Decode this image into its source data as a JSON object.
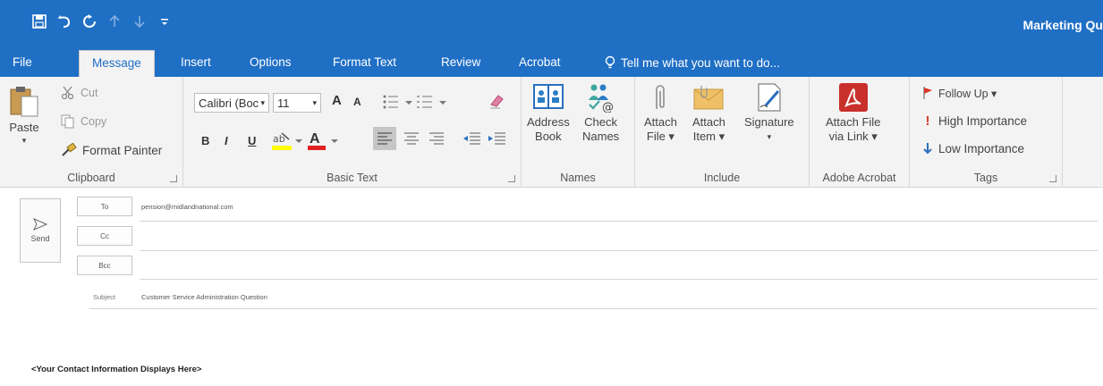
{
  "window": {
    "title": "Marketing Qu"
  },
  "qat": {
    "items": [
      {
        "name": "save-icon",
        "glyph": "🖫"
      },
      {
        "name": "undo-icon",
        "glyph": "↶"
      },
      {
        "name": "redo-icon",
        "glyph": "↻"
      },
      {
        "name": "up-icon",
        "glyph": "↑"
      },
      {
        "name": "down-icon",
        "glyph": "↓"
      },
      {
        "name": "customize-icon",
        "glyph": "="
      }
    ]
  },
  "tabs": [
    {
      "label": "File"
    },
    {
      "label": "Message"
    },
    {
      "label": "Insert"
    },
    {
      "label": "Options"
    },
    {
      "label": "Format Text"
    },
    {
      "label": "Review"
    },
    {
      "label": "Acrobat"
    }
  ],
  "tellme": {
    "label": "Tell me what you want to do..."
  },
  "clipboard": {
    "paste": "Paste",
    "cut": "Cut",
    "copy": "Copy",
    "format_painter": "Format Painter",
    "label": "Clipboard"
  },
  "basic_text": {
    "font": "Calibri (Boc",
    "size": "11",
    "bold": "B",
    "italic": "I",
    "underline": "U",
    "grow": "A",
    "shrink": "A",
    "font_color": "A",
    "label": "Basic Text"
  },
  "names": {
    "address_book_1": "Address",
    "address_book_2": "Book",
    "check_names_1": "Check",
    "check_names_2": "Names",
    "label": "Names"
  },
  "include": {
    "attach_file_1": "Attach",
    "attach_file_2": "File ▾",
    "attach_item_1": "Attach",
    "attach_item_2": "Item ▾",
    "signature_1": "Signature",
    "signature_2": "▾",
    "label": "Include"
  },
  "adobe": {
    "attach_link_1": "Attach File",
    "attach_link_2": "via Link ▾",
    "label": "Adobe Acrobat"
  },
  "tags": {
    "follow_up": "Follow Up ▾",
    "high": "High Importance",
    "low": "Low Importance",
    "label": "Tags"
  },
  "compose": {
    "send": "Send",
    "to_label": "To",
    "cc_label": "Cc",
    "bcc_label": "Bcc",
    "to_value": "pension@midlandnational.com",
    "subject_label": "Subject",
    "subject_value": "Customer Service Administration Question",
    "body": "<Your Contact Information Displays Here>"
  },
  "colors": {
    "accent": "#1f6fc5",
    "pdf_red": "#c9302c",
    "flag_red": "#d9352b"
  }
}
